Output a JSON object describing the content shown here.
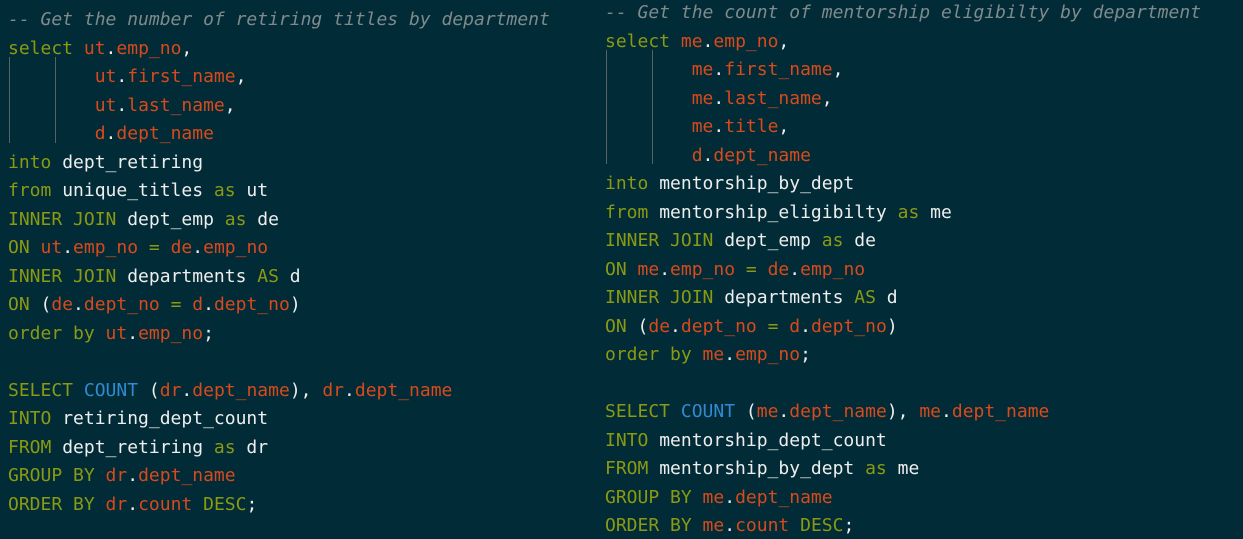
{
  "colors": {
    "background": "#012b36",
    "comment": "#7f8a8c",
    "keyword": "#8a9a13",
    "function": "#2f8bd2",
    "identifier": "#d84a1c",
    "plain": "#eeeeee",
    "indent_guide": "#56646a"
  },
  "panes": [
    {
      "lines": [
        [
          {
            "t": "c",
            "v": "-- Get the number of retiring titles by department"
          }
        ],
        [
          {
            "t": "k",
            "v": "select "
          },
          {
            "t": "i",
            "v": "ut"
          },
          {
            "t": "p",
            "v": "."
          },
          {
            "t": "i",
            "v": "emp_no"
          },
          {
            "t": "p",
            "v": ","
          }
        ],
        [
          {
            "t": "p",
            "v": "        "
          },
          {
            "t": "i",
            "v": "ut"
          },
          {
            "t": "p",
            "v": "."
          },
          {
            "t": "i",
            "v": "first_name"
          },
          {
            "t": "p",
            "v": ","
          }
        ],
        [
          {
            "t": "p",
            "v": "        "
          },
          {
            "t": "i",
            "v": "ut"
          },
          {
            "t": "p",
            "v": "."
          },
          {
            "t": "i",
            "v": "last_name"
          },
          {
            "t": "p",
            "v": ","
          }
        ],
        [
          {
            "t": "p",
            "v": "        "
          },
          {
            "t": "i",
            "v": "d"
          },
          {
            "t": "p",
            "v": "."
          },
          {
            "t": "i",
            "v": "dept_name"
          }
        ],
        [
          {
            "t": "k",
            "v": "into "
          },
          {
            "t": "p",
            "v": "dept_retiring"
          }
        ],
        [
          {
            "t": "k",
            "v": "from "
          },
          {
            "t": "p",
            "v": "unique_titles "
          },
          {
            "t": "k",
            "v": "as "
          },
          {
            "t": "p",
            "v": "ut"
          }
        ],
        [
          {
            "t": "k",
            "v": "INNER JOIN "
          },
          {
            "t": "p",
            "v": "dept_emp "
          },
          {
            "t": "k",
            "v": "as "
          },
          {
            "t": "p",
            "v": "de"
          }
        ],
        [
          {
            "t": "k",
            "v": "ON "
          },
          {
            "t": "i",
            "v": "ut"
          },
          {
            "t": "p",
            "v": "."
          },
          {
            "t": "i",
            "v": "emp_no"
          },
          {
            "t": "k",
            "v": " = "
          },
          {
            "t": "i",
            "v": "de"
          },
          {
            "t": "p",
            "v": "."
          },
          {
            "t": "i",
            "v": "emp_no"
          }
        ],
        [
          {
            "t": "k",
            "v": "INNER JOIN "
          },
          {
            "t": "p",
            "v": "departments "
          },
          {
            "t": "k",
            "v": "AS "
          },
          {
            "t": "p",
            "v": "d"
          }
        ],
        [
          {
            "t": "k",
            "v": "ON "
          },
          {
            "t": "p",
            "v": "("
          },
          {
            "t": "i",
            "v": "de"
          },
          {
            "t": "p",
            "v": "."
          },
          {
            "t": "i",
            "v": "dept_no"
          },
          {
            "t": "k",
            "v": " = "
          },
          {
            "t": "i",
            "v": "d"
          },
          {
            "t": "p",
            "v": "."
          },
          {
            "t": "i",
            "v": "dept_no"
          },
          {
            "t": "p",
            "v": ")"
          }
        ],
        [
          {
            "t": "k",
            "v": "order by "
          },
          {
            "t": "i",
            "v": "ut"
          },
          {
            "t": "p",
            "v": "."
          },
          {
            "t": "i",
            "v": "emp_no"
          },
          {
            "t": "p",
            "v": ";"
          }
        ],
        [],
        [
          {
            "t": "k",
            "v": "SELECT "
          },
          {
            "t": "f",
            "v": "COUNT"
          },
          {
            "t": "p",
            "v": " ("
          },
          {
            "t": "i",
            "v": "dr"
          },
          {
            "t": "p",
            "v": "."
          },
          {
            "t": "i",
            "v": "dept_name"
          },
          {
            "t": "p",
            "v": "), "
          },
          {
            "t": "i",
            "v": "dr"
          },
          {
            "t": "p",
            "v": "."
          },
          {
            "t": "i",
            "v": "dept_name"
          }
        ],
        [
          {
            "t": "k",
            "v": "INTO "
          },
          {
            "t": "p",
            "v": "retiring_dept_count"
          }
        ],
        [
          {
            "t": "k",
            "v": "FROM "
          },
          {
            "t": "p",
            "v": "dept_retiring "
          },
          {
            "t": "k",
            "v": "as "
          },
          {
            "t": "p",
            "v": "dr"
          }
        ],
        [
          {
            "t": "k",
            "v": "GROUP BY "
          },
          {
            "t": "i",
            "v": "dr"
          },
          {
            "t": "p",
            "v": "."
          },
          {
            "t": "i",
            "v": "dept_name"
          }
        ],
        [
          {
            "t": "k",
            "v": "ORDER BY "
          },
          {
            "t": "i",
            "v": "dr"
          },
          {
            "t": "p",
            "v": "."
          },
          {
            "t": "i",
            "v": "count"
          },
          {
            "t": "k",
            "v": " DESC"
          },
          {
            "t": "p",
            "v": ";"
          }
        ]
      ]
    },
    {
      "lines": [
        [
          {
            "t": "c",
            "v": "-- Get the count of mentorship eligibilty by department"
          }
        ],
        [
          {
            "t": "k",
            "v": "select "
          },
          {
            "t": "i",
            "v": "me"
          },
          {
            "t": "p",
            "v": "."
          },
          {
            "t": "i",
            "v": "emp_no"
          },
          {
            "t": "p",
            "v": ","
          }
        ],
        [
          {
            "t": "p",
            "v": "        "
          },
          {
            "t": "i",
            "v": "me"
          },
          {
            "t": "p",
            "v": "."
          },
          {
            "t": "i",
            "v": "first_name"
          },
          {
            "t": "p",
            "v": ","
          }
        ],
        [
          {
            "t": "p",
            "v": "        "
          },
          {
            "t": "i",
            "v": "me"
          },
          {
            "t": "p",
            "v": "."
          },
          {
            "t": "i",
            "v": "last_name"
          },
          {
            "t": "p",
            "v": ","
          }
        ],
        [
          {
            "t": "p",
            "v": "        "
          },
          {
            "t": "i",
            "v": "me"
          },
          {
            "t": "p",
            "v": "."
          },
          {
            "t": "i",
            "v": "title"
          },
          {
            "t": "p",
            "v": ","
          }
        ],
        [
          {
            "t": "p",
            "v": "        "
          },
          {
            "t": "i",
            "v": "d"
          },
          {
            "t": "p",
            "v": "."
          },
          {
            "t": "i",
            "v": "dept_name"
          }
        ],
        [
          {
            "t": "k",
            "v": "into "
          },
          {
            "t": "p",
            "v": "mentorship_by_dept"
          }
        ],
        [
          {
            "t": "k",
            "v": "from "
          },
          {
            "t": "p",
            "v": "mentorship_eligibilty "
          },
          {
            "t": "k",
            "v": "as "
          },
          {
            "t": "p",
            "v": "me"
          }
        ],
        [
          {
            "t": "k",
            "v": "INNER JOIN "
          },
          {
            "t": "p",
            "v": "dept_emp "
          },
          {
            "t": "k",
            "v": "as "
          },
          {
            "t": "p",
            "v": "de"
          }
        ],
        [
          {
            "t": "k",
            "v": "ON "
          },
          {
            "t": "i",
            "v": "me"
          },
          {
            "t": "p",
            "v": "."
          },
          {
            "t": "i",
            "v": "emp_no"
          },
          {
            "t": "k",
            "v": " = "
          },
          {
            "t": "i",
            "v": "de"
          },
          {
            "t": "p",
            "v": "."
          },
          {
            "t": "i",
            "v": "emp_no"
          }
        ],
        [
          {
            "t": "k",
            "v": "INNER JOIN "
          },
          {
            "t": "p",
            "v": "departments "
          },
          {
            "t": "k",
            "v": "AS "
          },
          {
            "t": "p",
            "v": "d"
          }
        ],
        [
          {
            "t": "k",
            "v": "ON "
          },
          {
            "t": "p",
            "v": "("
          },
          {
            "t": "i",
            "v": "de"
          },
          {
            "t": "p",
            "v": "."
          },
          {
            "t": "i",
            "v": "dept_no"
          },
          {
            "t": "k",
            "v": " = "
          },
          {
            "t": "i",
            "v": "d"
          },
          {
            "t": "p",
            "v": "."
          },
          {
            "t": "i",
            "v": "dept_no"
          },
          {
            "t": "p",
            "v": ")"
          }
        ],
        [
          {
            "t": "k",
            "v": "order by "
          },
          {
            "t": "i",
            "v": "me"
          },
          {
            "t": "p",
            "v": "."
          },
          {
            "t": "i",
            "v": "emp_no"
          },
          {
            "t": "p",
            "v": ";"
          }
        ],
        [],
        [
          {
            "t": "k",
            "v": "SELECT "
          },
          {
            "t": "f",
            "v": "COUNT"
          },
          {
            "t": "p",
            "v": " ("
          },
          {
            "t": "i",
            "v": "me"
          },
          {
            "t": "p",
            "v": "."
          },
          {
            "t": "i",
            "v": "dept_name"
          },
          {
            "t": "p",
            "v": "), "
          },
          {
            "t": "i",
            "v": "me"
          },
          {
            "t": "p",
            "v": "."
          },
          {
            "t": "i",
            "v": "dept_name"
          }
        ],
        [
          {
            "t": "k",
            "v": "INTO "
          },
          {
            "t": "p",
            "v": "mentorship_dept_count"
          }
        ],
        [
          {
            "t": "k",
            "v": "FROM "
          },
          {
            "t": "p",
            "v": "mentorship_by_dept "
          },
          {
            "t": "k",
            "v": "as "
          },
          {
            "t": "p",
            "v": "me"
          }
        ],
        [
          {
            "t": "k",
            "v": "GROUP BY "
          },
          {
            "t": "i",
            "v": "me"
          },
          {
            "t": "p",
            "v": "."
          },
          {
            "t": "i",
            "v": "dept_name"
          }
        ],
        [
          {
            "t": "k",
            "v": "ORDER BY "
          },
          {
            "t": "i",
            "v": "me"
          },
          {
            "t": "p",
            "v": "."
          },
          {
            "t": "i",
            "v": "count"
          },
          {
            "t": "k",
            "v": " DESC"
          },
          {
            "t": "p",
            "v": ";"
          }
        ]
      ]
    }
  ]
}
